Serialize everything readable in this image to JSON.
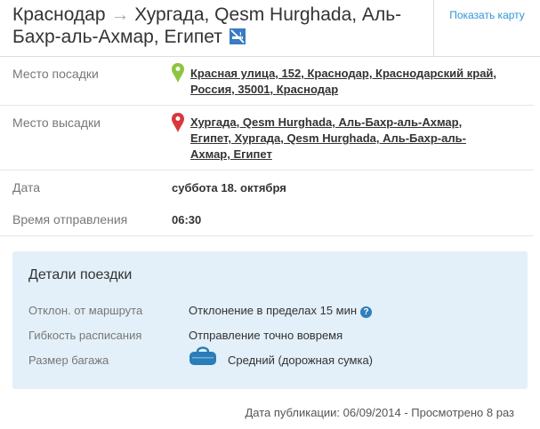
{
  "header": {
    "from": "Краснодар",
    "arrow": "→",
    "to": "Хургада, Qesm Hurghada, Аль-Бахр-аль-Ахмар, Египет",
    "map_link": "Показать карту"
  },
  "rows": {
    "pickup": {
      "label": "Место посадки",
      "address": "Красная улица, 152, Краснодар, Краснодарский край, Россия, 35001, Краснодар"
    },
    "dropoff": {
      "label": "Место высадки",
      "address": "Хургада, Qesm Hurghada, Аль-Бахр-аль-Ахмар, Египет, Хургада, Qesm Hurghada, Аль-Бахр-аль-Ахмар, Египет"
    },
    "date": {
      "label": "Дата",
      "value": "суббота 18. октября"
    },
    "time": {
      "label": "Время отправления",
      "value": "06:30"
    }
  },
  "details": {
    "title": "Детали поездки",
    "detour": {
      "label": "Отклон. от маршрута",
      "value": "Отклонение в пределах 15 мин",
      "help": "?"
    },
    "flexibility": {
      "label": "Гибкость расписания",
      "value": "Отправление точно вовремя"
    },
    "luggage": {
      "label": "Размер багажа",
      "value": "Средний (дорожная сумка)"
    }
  },
  "footer": {
    "text": "Дата публикации: 06/09/2014 - Просмотрено 8 раз"
  },
  "icons": {
    "pickup_pin": "green-map-pin-icon",
    "dropoff_pin": "red-map-pin-icon",
    "no_smoking": "no-smoking-icon",
    "help": "help-icon",
    "luggage": "bag-icon"
  },
  "colors": {
    "link": "#2f96d6",
    "pickup_pin": "#8cc63f",
    "dropoff_pin": "#d9363e",
    "details_bg": "#e3f0f9",
    "help_icon": "#2f7fbf"
  }
}
